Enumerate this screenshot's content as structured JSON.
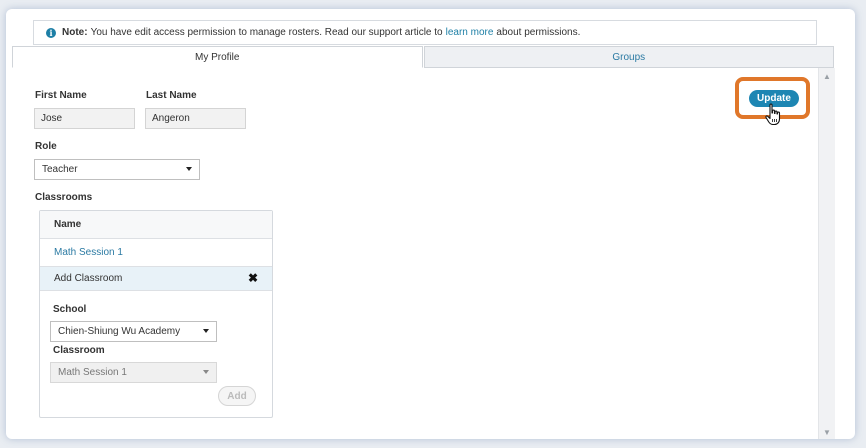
{
  "note": {
    "bold": "Note:",
    "text": "You have edit access permission to manage rosters. Read our support article to",
    "link": "learn more",
    "suffix": "about permissions."
  },
  "tabs": [
    {
      "label": "My Profile",
      "active": true
    },
    {
      "label": "Groups",
      "active": false
    }
  ],
  "form": {
    "first_name_label": "First Name",
    "first_name_value": "Jose",
    "last_name_label": "Last Name",
    "last_name_value": "Angeron",
    "role_label": "Role",
    "role_value": "Teacher",
    "classrooms_label": "Classrooms"
  },
  "classrooms": {
    "header": "Name",
    "rows": [
      "Math Session 1"
    ],
    "add_label": "Add Classroom",
    "school_label": "School",
    "school_value": "Chien-Shiung Wu Academy",
    "classroom_label": "Classroom",
    "classroom_value": "Math Session 1",
    "add_button": "Add"
  },
  "update_button": "Update",
  "colors": {
    "accent": "#1d86b3",
    "link": "#2b7aa3",
    "highlight": "#e0772a"
  }
}
